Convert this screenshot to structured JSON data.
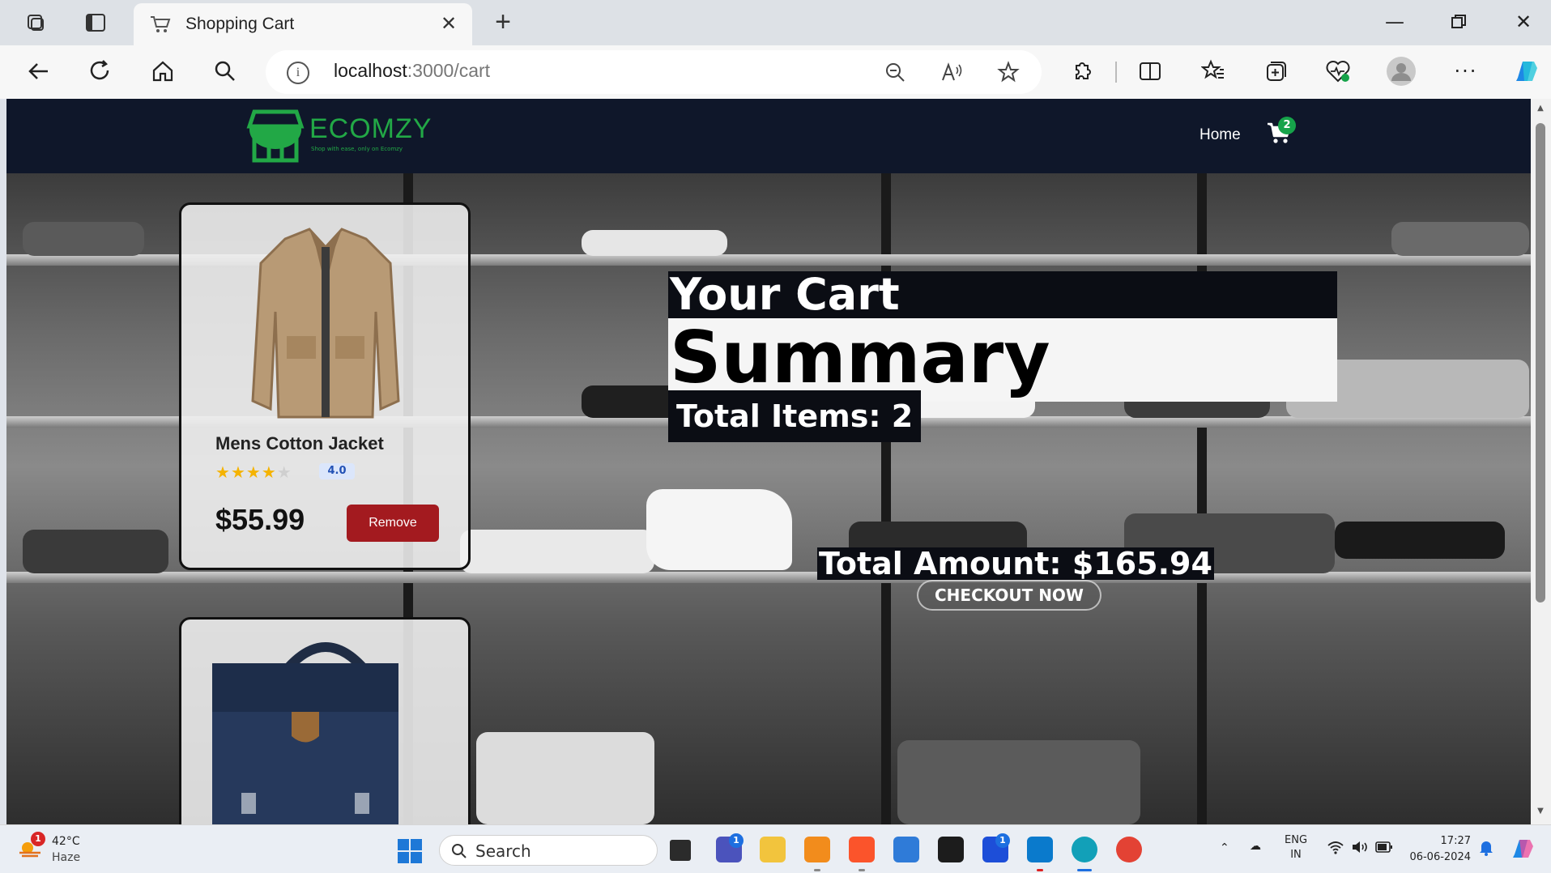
{
  "browser": {
    "tab_title": "Shopping Cart",
    "url_host": "localhost",
    "url_path": ":3000/cart",
    "icons": [
      "workspaces-icon",
      "tab-actions-icon",
      "cart-favicon",
      "close-icon",
      "new-tab-icon",
      "minimize-icon",
      "maximize-icon",
      "close-window-icon",
      "back-icon",
      "refresh-icon",
      "home-icon",
      "search-icon",
      "info-icon",
      "zoom-out-icon",
      "read-aloud-icon",
      "favorite-star-icon",
      "extensions-icon",
      "split-screen-icon",
      "favorites-icon",
      "collections-icon",
      "browser-essentials-icon",
      "profile-icon",
      "more-icon",
      "copilot-icon"
    ]
  },
  "site": {
    "brand": "ECOMZY",
    "tagline": "Shop with ease, only on Ecomzy",
    "nav_home": "Home",
    "cart_count": "2",
    "brand_color": "#22a846",
    "nav_bg": "#0f172a"
  },
  "cart": {
    "items": [
      {
        "title": "Mens Cotton Jacket",
        "rating": "4.0",
        "stars_filled": 4,
        "stars_total": 5,
        "price": "$55.99",
        "remove_label": "Remove"
      },
      {
        "title": "",
        "rating": "",
        "price": "",
        "remove_label": ""
      }
    ]
  },
  "summary": {
    "heading": "Your Cart",
    "subheading": "Summary",
    "total_items": "Total Items: 2",
    "total_amount": "Total Amount: $165.94",
    "checkout_label": "CHECKOUT NOW"
  },
  "taskbar": {
    "temperature": "42°C",
    "weather": "Haze",
    "weather_badge": "1",
    "search_placeholder": "Search",
    "language_top": "ENG",
    "language_bottom": "IN",
    "time": "17:27",
    "date": "06-06-2024",
    "teams_badge": "1",
    "l_badge": "1"
  },
  "colors": {
    "remove_button": "#a31a1f",
    "rating_bg": "#dbe6fb",
    "star": "#f5b301"
  }
}
